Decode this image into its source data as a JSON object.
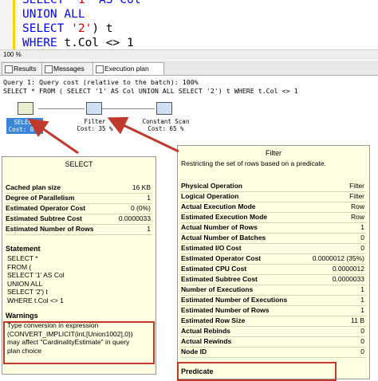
{
  "editor": {
    "lines": [
      {
        "parts": [
          {
            "t": "SELECT ",
            "c": "kw"
          },
          {
            "t": "'1'",
            "c": "str"
          },
          {
            "t": " AS Col",
            "c": "kw"
          }
        ]
      },
      {
        "parts": [
          {
            "t": "UNION ALL",
            "c": "kw"
          }
        ]
      },
      {
        "parts": [
          {
            "t": "SELECT ",
            "c": "kw"
          },
          {
            "t": "'2'",
            "c": "str"
          },
          {
            "t": ") t",
            "c": "plain"
          }
        ]
      },
      {
        "parts": [
          {
            "t": "WHERE ",
            "c": "kw"
          },
          {
            "t": "t.Col <> 1",
            "c": "plain"
          }
        ]
      }
    ],
    "zoom": "100 %"
  },
  "tabs": [
    {
      "label": "Results"
    },
    {
      "label": "Messages"
    },
    {
      "label": "Execution plan"
    }
  ],
  "query": {
    "line1": "Query 1: Query cost (relative to the batch): 100%",
    "line2": "SELECT * FROM ( SELECT '1' AS Col UNION ALL SELECT '2') t WHERE t.Col <> 1"
  },
  "plan_nodes": {
    "select": {
      "name": "SELECT",
      "cost": "Cost: 0 %"
    },
    "filter": {
      "name": "Filter",
      "cost": "Cost: 35 %"
    },
    "scan": {
      "name": "Constant Scan",
      "cost": "Cost: 65 %"
    }
  },
  "select_tooltip": {
    "title": "SELECT",
    "rows": [
      {
        "k": "Cached plan size",
        "v": "16 KB"
      },
      {
        "k": "Degree of Parallelism",
        "v": "1"
      },
      {
        "k": "Estimated Operator Cost",
        "v": "0 (0%)"
      },
      {
        "k": "Estimated Subtree Cost",
        "v": "0.0000033"
      },
      {
        "k": "Estimated Number of Rows",
        "v": "1"
      }
    ],
    "statement_header": "Statement",
    "statement": "SELECT *\nFROM (\nSELECT '1' AS Col\nUNION ALL\nSELECT '2') t\nWHERE t.Col <> 1",
    "warnings_header": "Warnings",
    "warnings": "Type conversion in expression\n(CONVERT_IMPLICIT(int,[Union1002],0))\nmay affect \"CardinalityEstimate\" in query\nplan choice"
  },
  "filter_tooltip": {
    "title": "Filter",
    "desc": "Restricting the set of rows based on a predicate.",
    "rows": [
      {
        "k": "Physical Operation",
        "v": "Filter"
      },
      {
        "k": "Logical Operation",
        "v": "Filter"
      },
      {
        "k": "Actual Execution Mode",
        "v": "Row"
      },
      {
        "k": "Estimated Execution Mode",
        "v": "Row"
      },
      {
        "k": "Actual Number of Rows",
        "v": "1"
      },
      {
        "k": "Actual Number of Batches",
        "v": "0"
      },
      {
        "k": "Estimated I/O Cost",
        "v": "0"
      },
      {
        "k": "Estimated Operator Cost",
        "v": "0.0000012 (35%)"
      },
      {
        "k": "Estimated CPU Cost",
        "v": "0.0000012"
      },
      {
        "k": "Estimated Subtree Cost",
        "v": "0.0000033"
      },
      {
        "k": "Number of Executions",
        "v": "1"
      },
      {
        "k": "Estimated Number of Executions",
        "v": "1"
      },
      {
        "k": "Estimated Number of Rows",
        "v": "1"
      },
      {
        "k": "Estimated Row Size",
        "v": "11 B"
      },
      {
        "k": "Actual Rebinds",
        "v": "0"
      },
      {
        "k": "Actual Rewinds",
        "v": "0"
      },
      {
        "k": "Node ID",
        "v": "0"
      }
    ],
    "predicate_header": "Predicate"
  },
  "colors": {
    "accent": "#3c86d9",
    "highlight": "#c0392b",
    "tooltip_bg": "#ffffe1"
  }
}
